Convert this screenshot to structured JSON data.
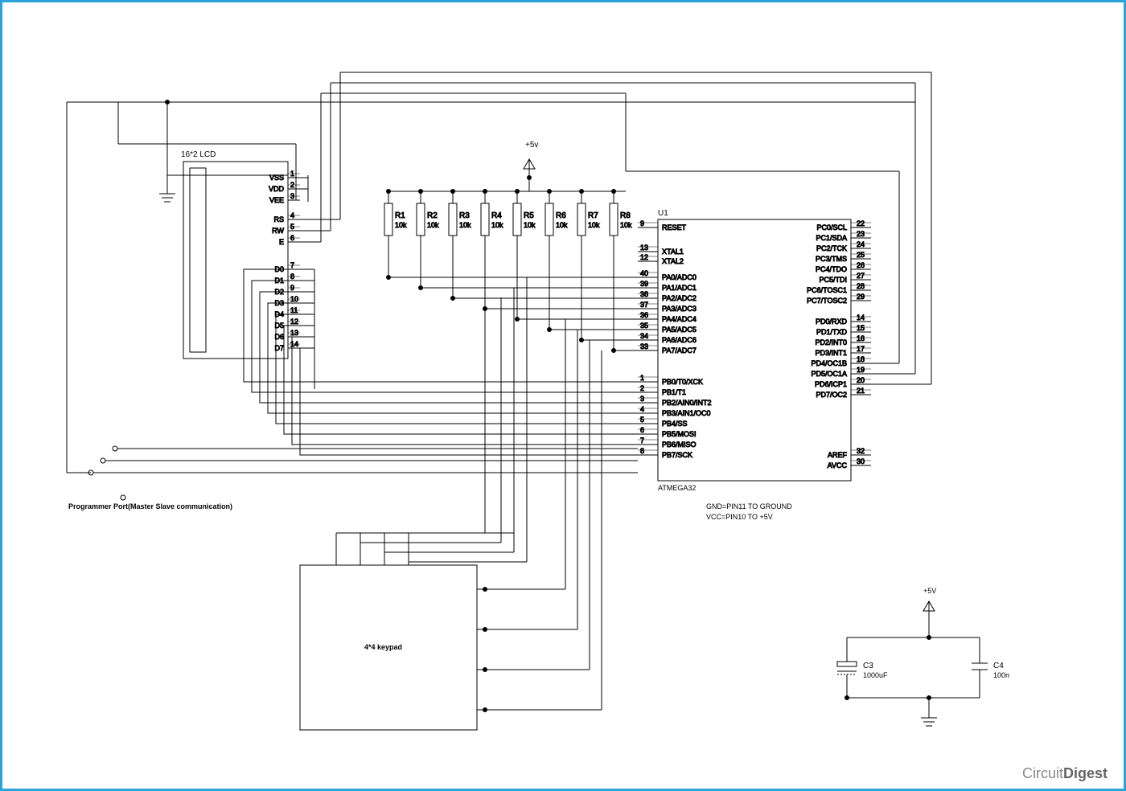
{
  "lcd": {
    "title": "16*2 LCD",
    "pins": [
      {
        "n": "1",
        "l": "VSS"
      },
      {
        "n": "2",
        "l": "VDD"
      },
      {
        "n": "3",
        "l": "VEE"
      },
      {
        "n": "4",
        "l": "RS"
      },
      {
        "n": "5",
        "l": "RW"
      },
      {
        "n": "6",
        "l": "E"
      },
      {
        "n": "7",
        "l": "D0"
      },
      {
        "n": "8",
        "l": "D1"
      },
      {
        "n": "9",
        "l": "D2"
      },
      {
        "n": "10",
        "l": "D3"
      },
      {
        "n": "11",
        "l": "D4"
      },
      {
        "n": "12",
        "l": "D5"
      },
      {
        "n": "13",
        "l": "D6"
      },
      {
        "n": "14",
        "l": "D7"
      }
    ]
  },
  "resistors": [
    {
      "ref": "R1",
      "val": "10k"
    },
    {
      "ref": "R2",
      "val": "10k"
    },
    {
      "ref": "R3",
      "val": "10k"
    },
    {
      "ref": "R4",
      "val": "10k"
    },
    {
      "ref": "R5",
      "val": "10k"
    },
    {
      "ref": "R6",
      "val": "10k"
    },
    {
      "ref": "R7",
      "val": "10k"
    },
    {
      "ref": "R8",
      "val": "10k"
    }
  ],
  "mcu": {
    "ref": "U1",
    "part": "ATMEGA32",
    "left": [
      {
        "n": "9",
        "l": "RESET"
      },
      {
        "n": "13",
        "l": "XTAL1"
      },
      {
        "n": "12",
        "l": "XTAL2"
      },
      {
        "n": "40",
        "l": "PA0/ADC0"
      },
      {
        "n": "39",
        "l": "PA1/ADC1"
      },
      {
        "n": "38",
        "l": "PA2/ADC2"
      },
      {
        "n": "37",
        "l": "PA3/ADC3"
      },
      {
        "n": "36",
        "l": "PA4/ADC4"
      },
      {
        "n": "35",
        "l": "PA5/ADC5"
      },
      {
        "n": "34",
        "l": "PA6/ADC6"
      },
      {
        "n": "33",
        "l": "PA7/ADC7"
      },
      {
        "n": "1",
        "l": "PB0/T0/XCK"
      },
      {
        "n": "2",
        "l": "PB1/T1"
      },
      {
        "n": "3",
        "l": "PB2/AIN0/INT2"
      },
      {
        "n": "4",
        "l": "PB3/AIN1/OC0"
      },
      {
        "n": "5",
        "l": "PB4/SS"
      },
      {
        "n": "6",
        "l": "PB5/MOSI"
      },
      {
        "n": "7",
        "l": "PB6/MISO"
      },
      {
        "n": "8",
        "l": "PB7/SCK"
      }
    ],
    "right": [
      {
        "n": "22",
        "l": "PC0/SCL"
      },
      {
        "n": "23",
        "l": "PC1/SDA"
      },
      {
        "n": "24",
        "l": "PC2/TCK"
      },
      {
        "n": "25",
        "l": "PC3/TMS"
      },
      {
        "n": "26",
        "l": "PC4/TDO"
      },
      {
        "n": "27",
        "l": "PC5/TDI"
      },
      {
        "n": "28",
        "l": "PC6/TOSC1"
      },
      {
        "n": "29",
        "l": "PC7/TOSC2"
      },
      {
        "n": "14",
        "l": "PD0/RXD"
      },
      {
        "n": "15",
        "l": "PD1/TXD"
      },
      {
        "n": "16",
        "l": "PD2/INT0"
      },
      {
        "n": "17",
        "l": "PD3/INT1"
      },
      {
        "n": "18",
        "l": "PD4/OC1B"
      },
      {
        "n": "19",
        "l": "PD5/OC1A"
      },
      {
        "n": "20",
        "l": "PD6/ICP1"
      },
      {
        "n": "21",
        "l": "PD7/OC2"
      },
      {
        "n": "32",
        "l": "AREF"
      },
      {
        "n": "30",
        "l": "AVCC"
      }
    ]
  },
  "keypad": {
    "label": "4*4 keypad"
  },
  "caps": [
    {
      "ref": "C3",
      "val": "1000uF"
    },
    {
      "ref": "C4",
      "val": "100n"
    }
  ],
  "notes": {
    "gnd": "GND=PIN11  TO  GROUND",
    "vcc": "VCC=PIN10  TO  +5V",
    "prog": "Programmer Port(Master Slave communication)"
  },
  "rails": {
    "v5a": "+5v",
    "v5b": "+5V"
  },
  "watermark": {
    "a": "Circuit",
    "b": "Digest"
  }
}
